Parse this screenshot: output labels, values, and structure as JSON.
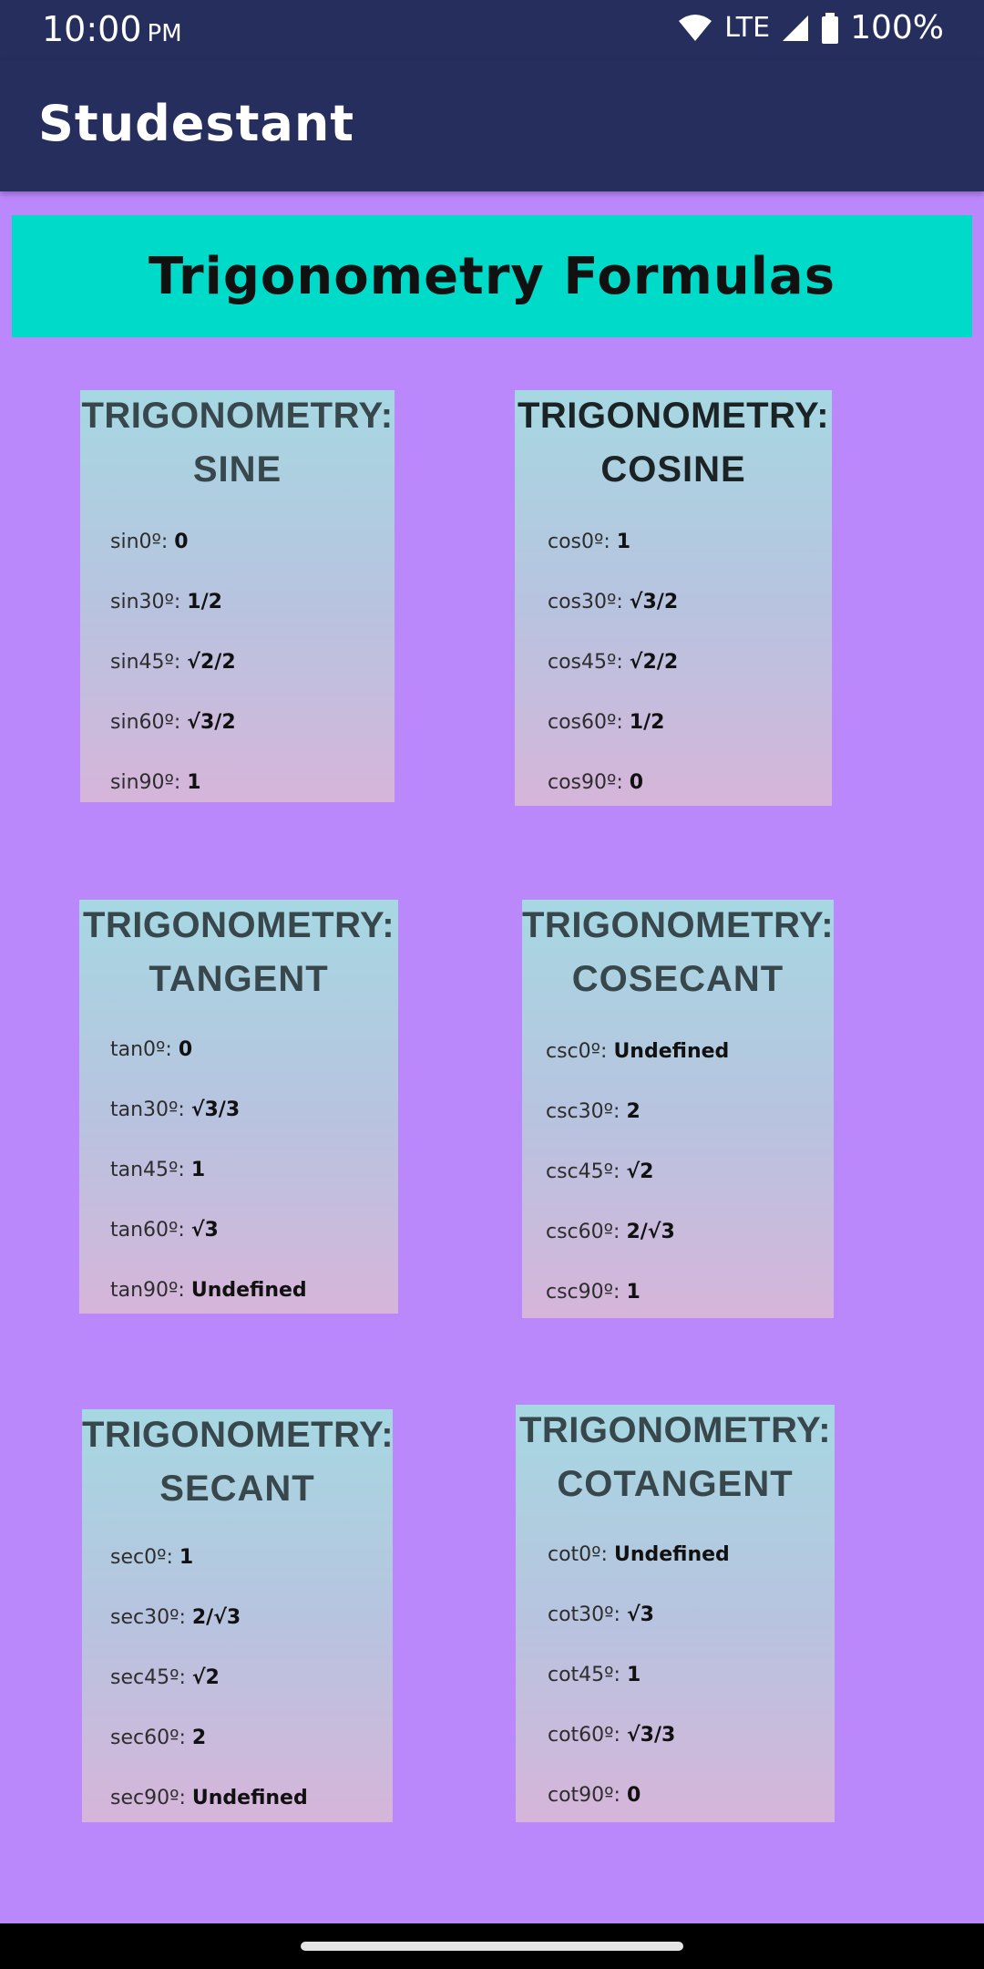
{
  "status_bar": {
    "time": "10:00",
    "ampm": "PM",
    "network": "LTE",
    "battery": "100%"
  },
  "app_bar": {
    "title": "Studestant"
  },
  "page": {
    "title": "Trigonometry Formulas"
  },
  "cards": [
    {
      "heading1": "TRIGONOMETRY:",
      "heading2": "SINE",
      "rows": [
        {
          "label": "sin0º:",
          "value": "0"
        },
        {
          "label": "sin30º:",
          "value": "1/2"
        },
        {
          "label": "sin45º:",
          "value": "√2/2"
        },
        {
          "label": "sin60º:",
          "value": "√3/2"
        },
        {
          "label": "sin90º:",
          "value": "1"
        }
      ]
    },
    {
      "heading1": "TRIGONOMETRY:",
      "heading2": "COSINE",
      "rows": [
        {
          "label": "cos0º:",
          "value": "1"
        },
        {
          "label": "cos30º:",
          "value": "√3/2"
        },
        {
          "label": "cos45º:",
          "value": "√2/2"
        },
        {
          "label": "cos60º:",
          "value": "1/2"
        },
        {
          "label": "cos90º:",
          "value": "0"
        }
      ]
    },
    {
      "heading1": "TRIGONOMETRY:",
      "heading2": "TANGENT",
      "rows": [
        {
          "label": "tan0º:",
          "value": "0"
        },
        {
          "label": "tan30º:",
          "value": "√3/3"
        },
        {
          "label": "tan45º:",
          "value": "1"
        },
        {
          "label": "tan60º:",
          "value": "√3"
        },
        {
          "label": "tan90º:",
          "value": "Undefined"
        }
      ]
    },
    {
      "heading1": "TRIGONOMETRY:",
      "heading2": "COSECANT",
      "rows": [
        {
          "label": "csc0º:",
          "value": "Undefined"
        },
        {
          "label": "csc30º:",
          "value": "2"
        },
        {
          "label": "csc45º:",
          "value": "√2"
        },
        {
          "label": "csc60º:",
          "value": "2/√3"
        },
        {
          "label": "csc90º:",
          "value": "1"
        }
      ]
    },
    {
      "heading1": "TRIGONOMETRY:",
      "heading2": "SECANT",
      "rows": [
        {
          "label": "sec0º:",
          "value": "1"
        },
        {
          "label": "sec30º:",
          "value": "2/√3"
        },
        {
          "label": "sec45º:",
          "value": "√2"
        },
        {
          "label": "sec60º:",
          "value": "2"
        },
        {
          "label": "sec90º:",
          "value": "Undefined"
        }
      ]
    },
    {
      "heading1": "TRIGONOMETRY:",
      "heading2": "COTANGENT",
      "rows": [
        {
          "label": "cot0º:",
          "value": "Undefined"
        },
        {
          "label": "cot30º:",
          "value": "√3"
        },
        {
          "label": "cot45º:",
          "value": "1"
        },
        {
          "label": "cot60º:",
          "value": "√3/3"
        },
        {
          "label": "cot90º:",
          "value": "0"
        }
      ]
    }
  ],
  "colors": {
    "app_bar": "#262e5e",
    "background": "#bb88fc",
    "banner": "#00dbc9"
  }
}
